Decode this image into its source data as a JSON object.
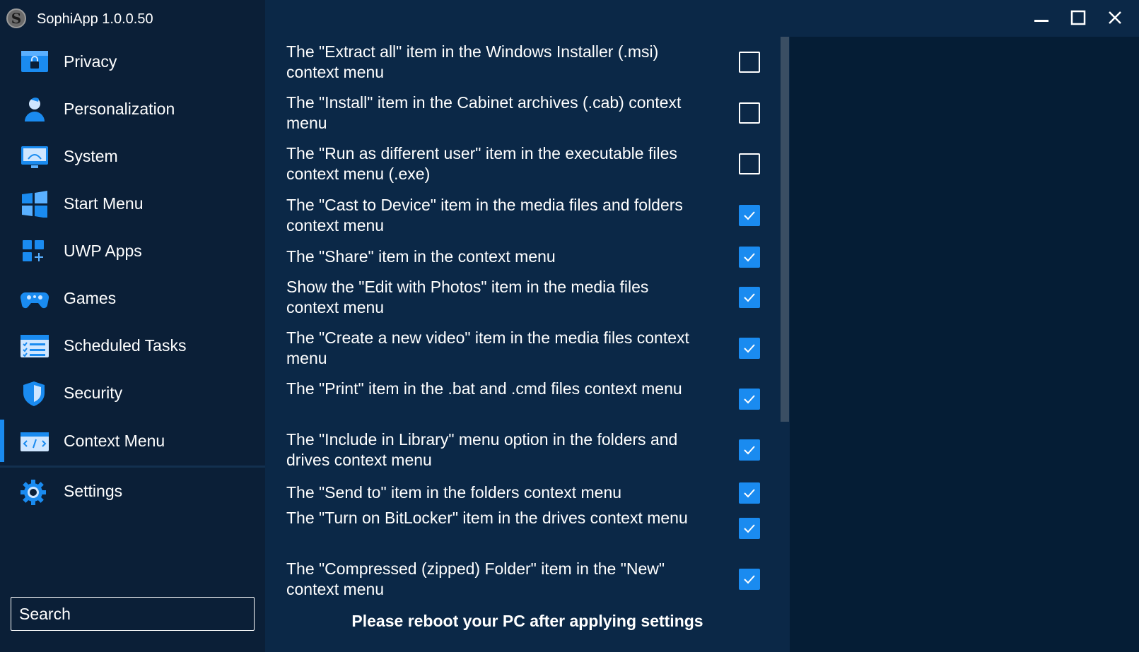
{
  "app": {
    "title": "SophiApp 1.0.0.50",
    "logo_letter": "S"
  },
  "sidebar": {
    "items": [
      {
        "label": "Privacy",
        "icon": "privacy-icon"
      },
      {
        "label": "Personalization",
        "icon": "personalization-icon"
      },
      {
        "label": "System",
        "icon": "system-icon"
      },
      {
        "label": "Start Menu",
        "icon": "start-menu-icon"
      },
      {
        "label": "UWP Apps",
        "icon": "uwp-apps-icon"
      },
      {
        "label": "Games",
        "icon": "games-icon"
      },
      {
        "label": "Scheduled Tasks",
        "icon": "scheduled-tasks-icon"
      },
      {
        "label": "Security",
        "icon": "security-icon"
      },
      {
        "label": "Context Menu",
        "icon": "context-menu-icon",
        "active": true
      },
      {
        "label": "Settings",
        "icon": "settings-icon"
      }
    ],
    "search_placeholder": "Search"
  },
  "content": {
    "items": [
      {
        "text": "The \"Extract all\" item in the Windows Installer (.msi) context menu",
        "checked": false
      },
      {
        "text": "The \"Install\" item in the Cabinet archives (.cab) context menu",
        "checked": false
      },
      {
        "text": "The \"Run as different user\" item in the executable files context menu (.exe)",
        "checked": false
      },
      {
        "text": "The \"Cast to Device\" item in the media files and folders context menu",
        "checked": true
      },
      {
        "text": "The \"Share\" item in the context menu",
        "checked": true
      },
      {
        "text": "Show the \"Edit with Photos\" item in the media files context menu",
        "checked": true
      },
      {
        "text": "The \"Create a new video\" item in the media files context menu",
        "checked": true
      },
      {
        "text": "The \"Print\" item in the .bat and .cmd files context menu",
        "checked": true
      },
      {
        "text": "The \"Include in Library\" menu option in the folders and drives context menu",
        "checked": true
      },
      {
        "text": "The \"Send to\" item in the folders context menu",
        "checked": true
      },
      {
        "text": "The \"Turn on BitLocker\" item in the drives context menu",
        "checked": true
      },
      {
        "text": "The \"Compressed (zipped) Folder\" item in the \"New\" context menu",
        "checked": true
      }
    ],
    "footer_note": "Please reboot your PC after applying settings"
  },
  "colors": {
    "sidebar_bg": "#0b1f37",
    "content_bg": "#0b2847",
    "right_pane_bg": "#051d35",
    "accent": "#1a8bf0"
  }
}
